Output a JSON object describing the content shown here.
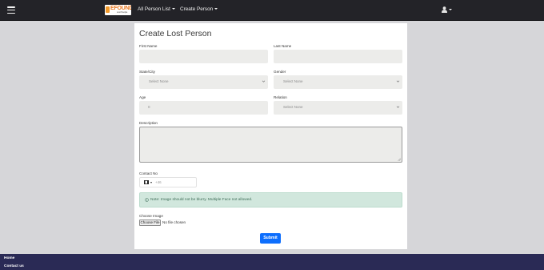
{
  "nav": {
    "logo_text": "EFOUND",
    "logo_sub": "Lost People",
    "items": [
      {
        "label": "All Person List"
      },
      {
        "label": "Create Person"
      }
    ]
  },
  "form": {
    "title": "Create Lost Person",
    "first_name": {
      "label": "First Name",
      "value": ""
    },
    "last_name": {
      "label": "Last Name",
      "value": ""
    },
    "state": {
      "label": "State/City",
      "selected": "Select None"
    },
    "gender": {
      "label": "Gender",
      "selected": "Select None"
    },
    "age": {
      "label": "Age",
      "value": "0"
    },
    "relation": {
      "label": "Relation",
      "selected": "Select None"
    },
    "description": {
      "label": "Description",
      "value": ""
    },
    "contact": {
      "label": "Contact No",
      "placeholder": "+46"
    },
    "note": "Note: Image should not be blurry. Multiple Face not allowed.",
    "image": {
      "label": "Choose Image",
      "button": "Choose File",
      "status": "No file chosen"
    },
    "submit_label": "Submit"
  },
  "footer": {
    "links": [
      {
        "label": "Home"
      },
      {
        "label": "Contact us"
      }
    ]
  },
  "colors": {
    "topbar": "#232328",
    "primary": "#0d6efd",
    "alert_bg": "#d1e7dd",
    "footer": "#2a2a55",
    "brand": "#e9761e"
  },
  "icons": [
    "menu-icon",
    "user-icon",
    "chevron-down-icon",
    "phone-flag-icon",
    "info-icon"
  ]
}
